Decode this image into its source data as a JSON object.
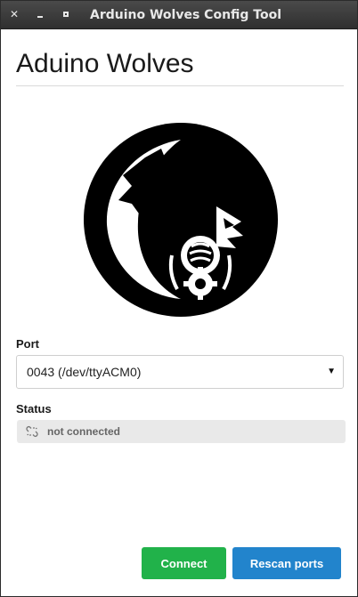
{
  "window": {
    "title": "Arduino Wolves Config Tool",
    "controls": {
      "close": "✕"
    }
  },
  "header": {
    "title": "Aduino Wolves"
  },
  "logo": {
    "icon": "wolf-logo-icon"
  },
  "port": {
    "label": "Port",
    "selected": "0043 (/dev/ttyACM0)"
  },
  "status": {
    "label": "Status",
    "text": "not connected",
    "icon": "unlinked-icon"
  },
  "actions": {
    "connect_label": "Connect",
    "rescan_label": "Rescan ports"
  },
  "colors": {
    "connect": "#21b24a",
    "rescan": "#2284cc",
    "titlebar": "#3a3a3a"
  }
}
